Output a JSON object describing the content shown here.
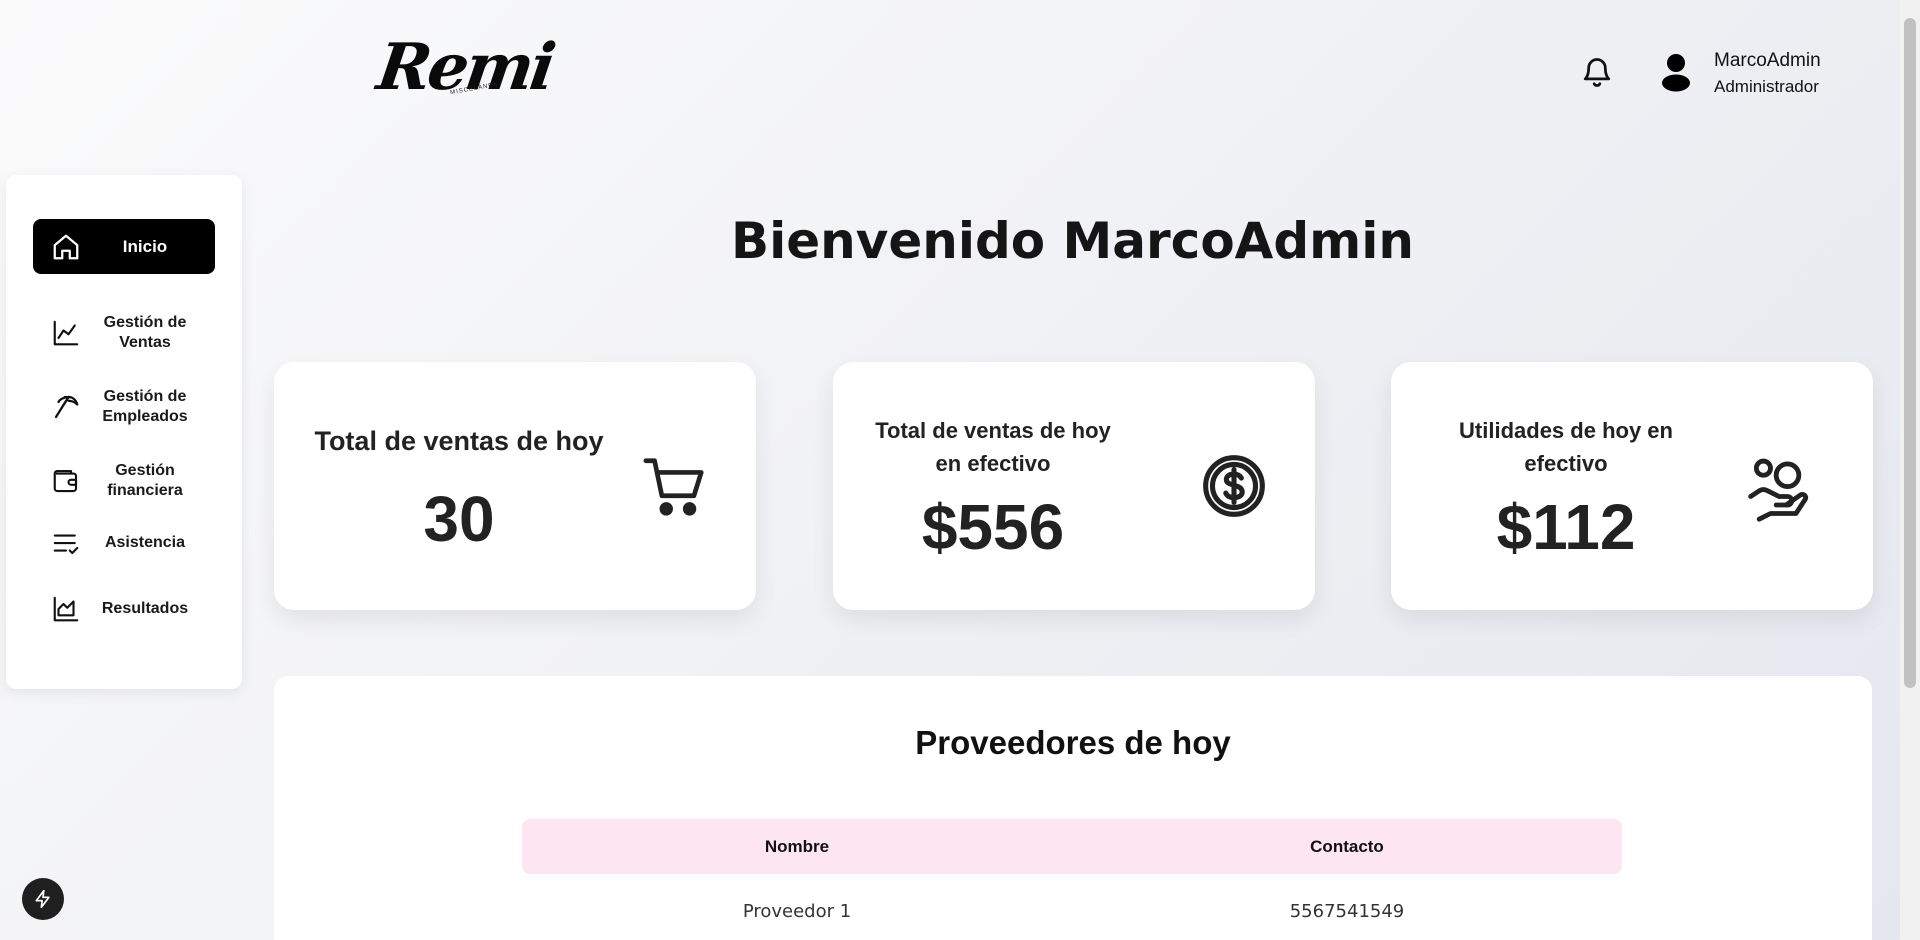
{
  "header": {
    "logo_text": "Remi",
    "logo_subtext": "MISCELÁNEA",
    "user_name": "MarcoAdmin",
    "user_role": "Administrador"
  },
  "sidebar": {
    "items": [
      {
        "label": "Inicio",
        "icon": "home-icon",
        "active": true
      },
      {
        "label": "Gestión de Ventas",
        "icon": "chart-line-icon"
      },
      {
        "label": "Gestión de Empleados",
        "icon": "pickaxe-icon"
      },
      {
        "label": "Gestión financiera",
        "icon": "wallet-icon"
      },
      {
        "label": "Asistencia",
        "icon": "list-check-icon"
      },
      {
        "label": "Resultados",
        "icon": "area-chart-icon"
      }
    ]
  },
  "main": {
    "welcome": "Bienvenido MarcoAdmin",
    "cards": [
      {
        "title": "Total de ventas de hoy",
        "value": "30",
        "icon": "cart-icon"
      },
      {
        "title": "Total de ventas de hoy en efectivo",
        "value": "$556",
        "icon": "dollar-circle-icon"
      },
      {
        "title": "Utilidades de hoy en efectivo",
        "value": "$112",
        "icon": "hand-coins-icon"
      }
    ],
    "providers": {
      "title": "Proveedores de hoy",
      "columns": [
        "Nombre",
        "Contacto"
      ],
      "rows": [
        [
          "Proveedor 1",
          "5567541549"
        ]
      ]
    }
  },
  "colors": {
    "active_nav": "#000000",
    "table_header": "#fde6f1",
    "card_bg": "#ffffff"
  }
}
